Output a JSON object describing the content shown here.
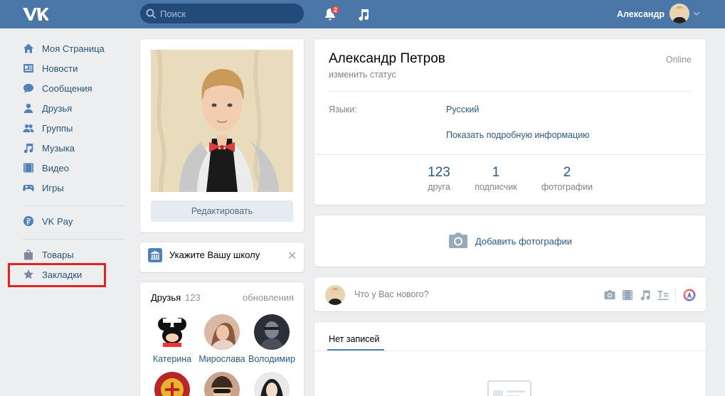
{
  "header": {
    "logo": "VK",
    "search_placeholder": "Поиск",
    "notifications_count": "2",
    "user_name": "Александр"
  },
  "sidebar": {
    "items": [
      {
        "label": "Моя Страница",
        "icon": "home-icon"
      },
      {
        "label": "Новости",
        "icon": "news-icon"
      },
      {
        "label": "Сообщения",
        "icon": "messages-icon"
      },
      {
        "label": "Друзья",
        "icon": "friends-icon"
      },
      {
        "label": "Группы",
        "icon": "groups-icon"
      },
      {
        "label": "Музыка",
        "icon": "music-icon"
      },
      {
        "label": "Видео",
        "icon": "video-icon"
      },
      {
        "label": "Игры",
        "icon": "games-icon"
      },
      {
        "label": "VK Pay",
        "icon": "vkpay-icon"
      },
      {
        "label": "Товары",
        "icon": "bag-icon"
      },
      {
        "label": "Закладки",
        "icon": "star-icon"
      }
    ]
  },
  "profile": {
    "edit_label": "Редактировать",
    "name": "Александр Петров",
    "status": "изменить статус",
    "online": "Online",
    "languages_label": "Языки:",
    "languages_value": "Русский",
    "more_info": "Показать подробную информацию",
    "stats": [
      {
        "value": "123",
        "label": "друга"
      },
      {
        "value": "1",
        "label": "подписчик"
      },
      {
        "value": "2",
        "label": "фотографии"
      }
    ]
  },
  "school": {
    "label": "Укажите Вашу школу",
    "close": "✕"
  },
  "friends": {
    "title": "Друзья",
    "count": "123",
    "updates": "обновления",
    "list": [
      {
        "name": "Катерина"
      },
      {
        "name": "Мирослава"
      },
      {
        "name": "Володимир"
      }
    ]
  },
  "photos": {
    "add_label": "Добавить фотографии"
  },
  "post": {
    "placeholder": "Что у Вас нового?"
  },
  "wall": {
    "tab": "Нет записей"
  },
  "colors": {
    "header": "#4a76a8",
    "link": "#2a5885",
    "highlight": "#e02424",
    "badge": "#e64646"
  }
}
